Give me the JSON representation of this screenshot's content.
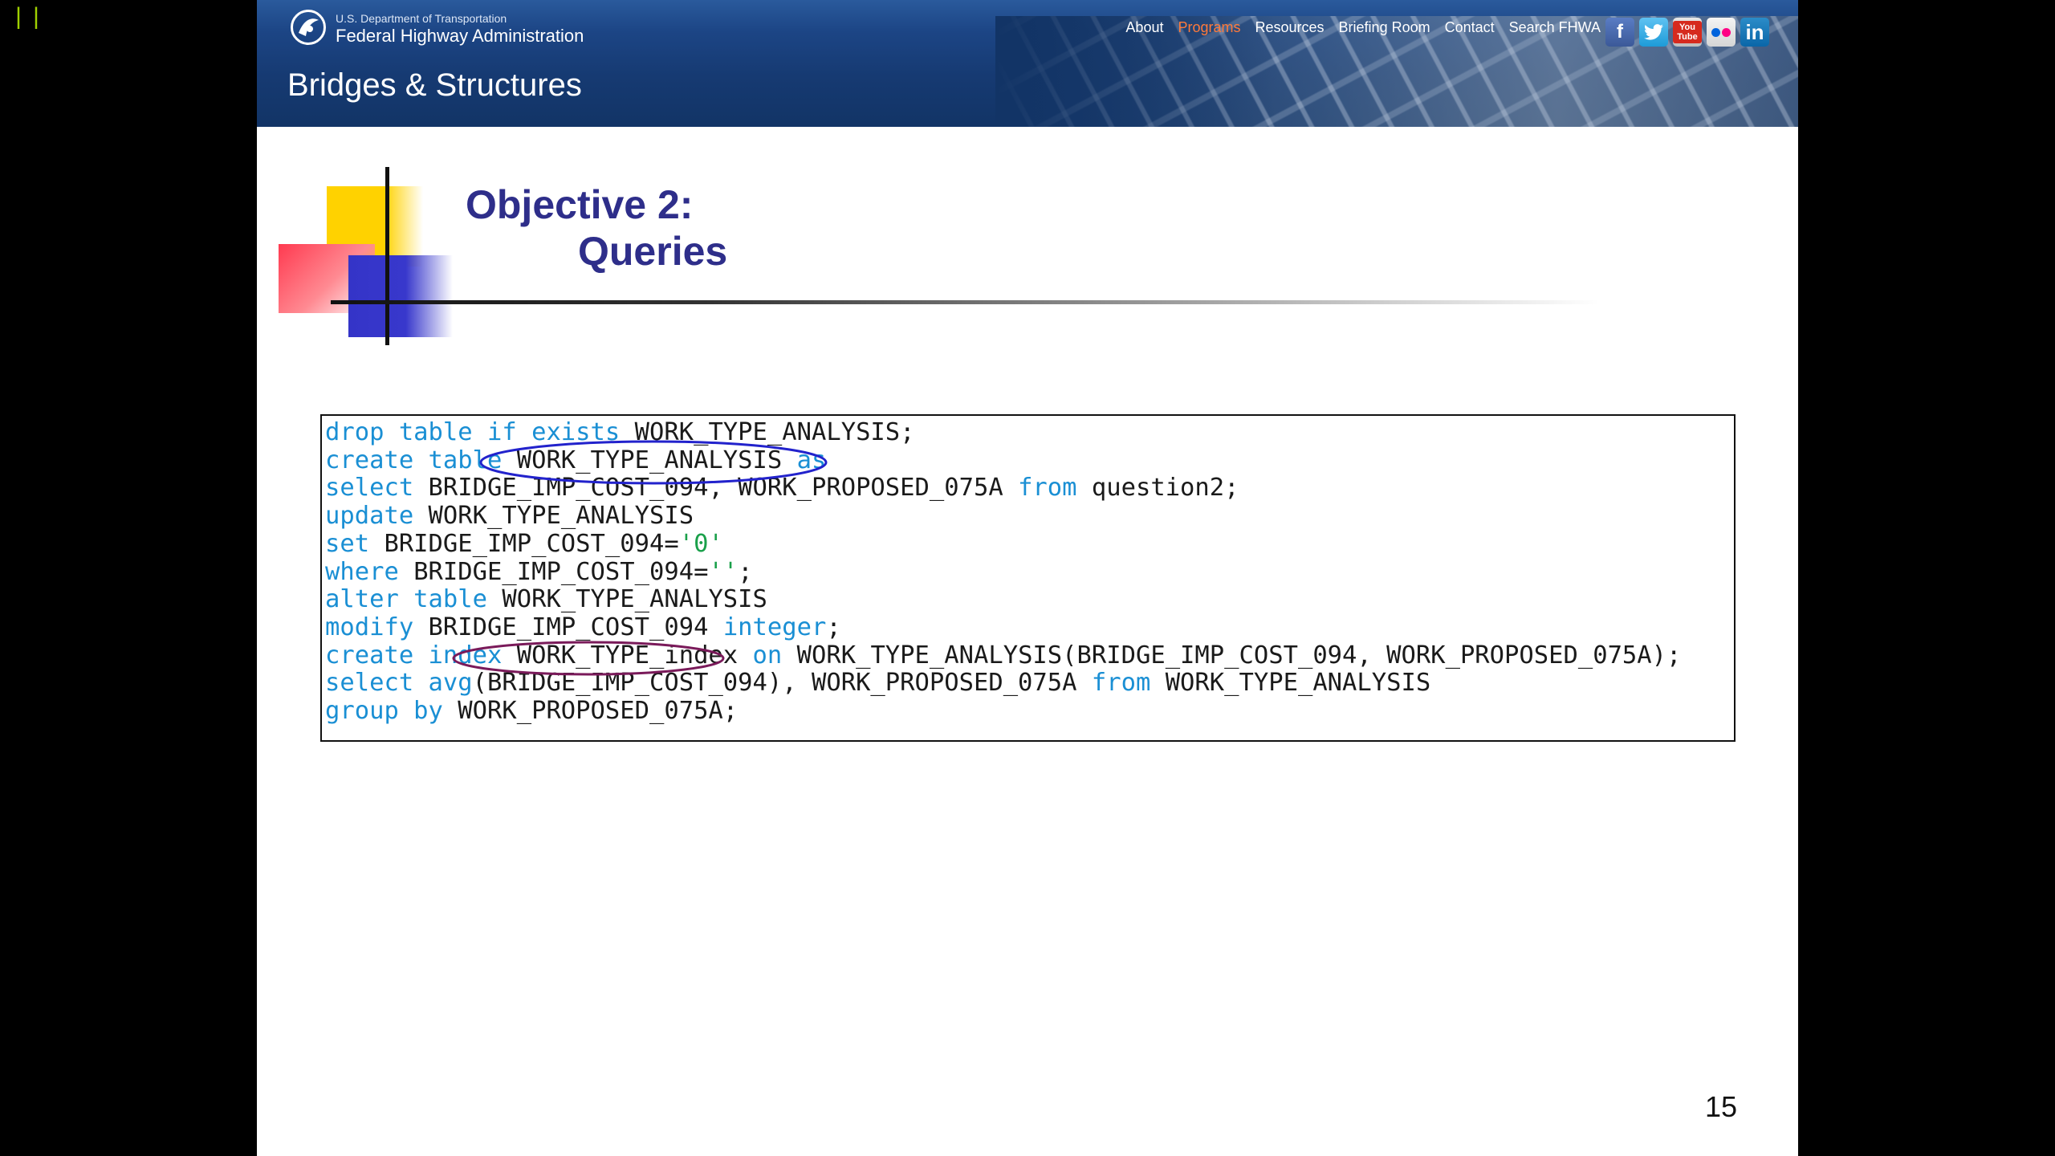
{
  "player": {
    "pause_glyph": "||"
  },
  "header": {
    "agency_small": "U.S. Department of Transportation",
    "agency_big": "Federal Highway Administration",
    "site_title": "Bridges & Structures",
    "nav": [
      {
        "label": "About",
        "active": false
      },
      {
        "label": "Programs",
        "active": true
      },
      {
        "label": "Resources",
        "active": false
      },
      {
        "label": "Briefing Room",
        "active": false
      },
      {
        "label": "Contact",
        "active": false
      },
      {
        "label": "Search FHWA",
        "active": false
      }
    ],
    "social": [
      {
        "name": "facebook-icon",
        "glyph": "f"
      },
      {
        "name": "twitter-icon",
        "glyph": "t"
      },
      {
        "name": "youtube-icon",
        "glyph": "You Tube"
      },
      {
        "name": "flickr-icon",
        "glyph": ""
      },
      {
        "name": "linkedin-icon",
        "glyph": "in"
      }
    ],
    "active_color": "#ff7a3a"
  },
  "slide": {
    "title_line1": "Objective 2:",
    "title_line2": "Queries",
    "page_number": "15",
    "code_lines": [
      [
        {
          "t": "drop table if exists",
          "c": "kw"
        },
        {
          "t": " WORK_TYPE_ANALYSIS;",
          "c": ""
        }
      ],
      [
        {
          "t": "create table",
          "c": "kw"
        },
        {
          "t": " WORK_TYPE_ANALYSIS ",
          "c": ""
        },
        {
          "t": "as",
          "c": "kw"
        }
      ],
      [
        {
          "t": "select",
          "c": "kw"
        },
        {
          "t": " BRIDGE_IMP_COST_094, WORK_PROPOSED_075A ",
          "c": ""
        },
        {
          "t": "from",
          "c": "kw"
        },
        {
          "t": " question2;",
          "c": ""
        }
      ],
      [
        {
          "t": "update",
          "c": "kw"
        },
        {
          "t": " WORK_TYPE_ANALYSIS",
          "c": ""
        }
      ],
      [
        {
          "t": "set",
          "c": "kw"
        },
        {
          "t": " BRIDGE_IMP_COST_094=",
          "c": ""
        },
        {
          "t": "'0'",
          "c": "str"
        }
      ],
      [
        {
          "t": "where",
          "c": "kw"
        },
        {
          "t": " BRIDGE_IMP_COST_094=",
          "c": ""
        },
        {
          "t": "''",
          "c": "str"
        },
        {
          "t": ";",
          "c": ""
        }
      ],
      [
        {
          "t": "alter table",
          "c": "kw"
        },
        {
          "t": " WORK_TYPE_ANALYSIS",
          "c": ""
        }
      ],
      [
        {
          "t": "modify",
          "c": "kw"
        },
        {
          "t": " BRIDGE_IMP_COST_094 ",
          "c": ""
        },
        {
          "t": "integer",
          "c": "kw"
        },
        {
          "t": ";",
          "c": ""
        }
      ],
      [
        {
          "t": "create index",
          "c": "kw"
        },
        {
          "t": " WORK_TYPE_index ",
          "c": ""
        },
        {
          "t": "on",
          "c": "kw"
        },
        {
          "t": " WORK_TYPE_ANALYSIS(BRIDGE_IMP_COST_094, WORK_PROPOSED_075A);",
          "c": ""
        }
      ],
      [
        {
          "t": "select avg",
          "c": "kw"
        },
        {
          "t": "(BRIDGE_IMP_COST_094), WORK_PROPOSED_075A ",
          "c": ""
        },
        {
          "t": "from",
          "c": "kw"
        },
        {
          "t": " WORK_TYPE_ANALYSIS",
          "c": ""
        }
      ],
      [
        {
          "t": "group by",
          "c": "kw"
        },
        {
          "t": " WORK_PROPOSED_075A;",
          "c": ""
        }
      ]
    ],
    "colors": {
      "keyword": "#1a8fd4",
      "string": "#1aa04a",
      "title": "#2e2e8a",
      "ellipse_blue": "#2222cc",
      "ellipse_purple": "#7a1a5a"
    }
  }
}
